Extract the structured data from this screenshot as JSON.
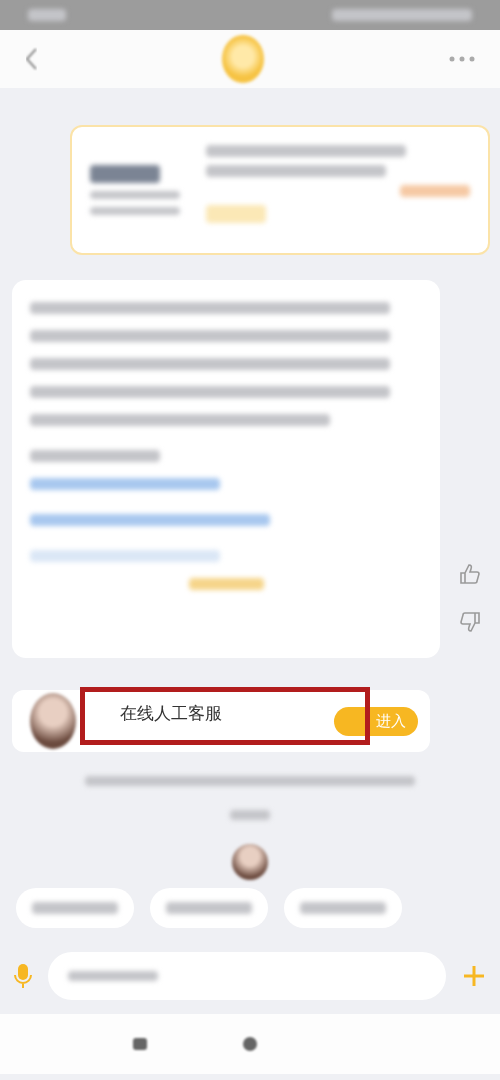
{
  "agent_card": {
    "title": "在线人工客服",
    "button": "进入",
    "highlighted": true
  }
}
